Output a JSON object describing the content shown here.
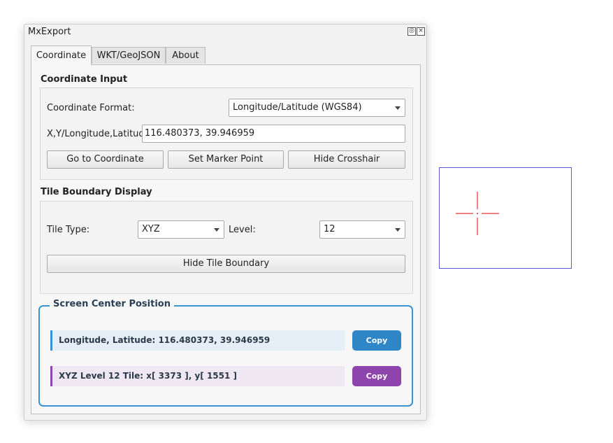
{
  "window": {
    "title": "MxExport"
  },
  "tabs": [
    "Coordinate",
    "WKT/GeoJSON",
    "About"
  ],
  "coordinate_input": {
    "title": "Coordinate Input",
    "format_label": "Coordinate Format:",
    "format_value": "Longitude/Latitude (WGS84)",
    "xy_label": "X,Y/Longitude,Latitude:",
    "xy_value": "116.480373, 39.946959",
    "buttons": [
      "Go to Coordinate",
      "Set Marker Point",
      "Hide Crosshair"
    ]
  },
  "tile_boundary": {
    "title": "Tile Boundary Display",
    "tile_type_label": "Tile Type:",
    "tile_type_value": "XYZ",
    "level_label": "Level:",
    "level_value": "12",
    "hide_button": "Hide Tile Boundary"
  },
  "screen_center": {
    "title": "Screen Center Position",
    "lonlat_text": "Longitude, Latitude: 116.480373, 39.946959",
    "tile_text": "XYZ Level 12 Tile: x[ 3373 ], y[ 1551 ]",
    "copy_label": "Copy"
  },
  "colors": {
    "frame_border": "#3a92cf",
    "lonlat_accent": "#3a92cf",
    "lonlat_bg": "#e6eef7",
    "tile_accent": "#8e44ad",
    "tile_bg": "#efe8f2",
    "copy_blue": "#2f86c6",
    "copy_purple": "#8e44ad",
    "crosshair": "#e8585a",
    "preview_border": "#5b55d8"
  }
}
